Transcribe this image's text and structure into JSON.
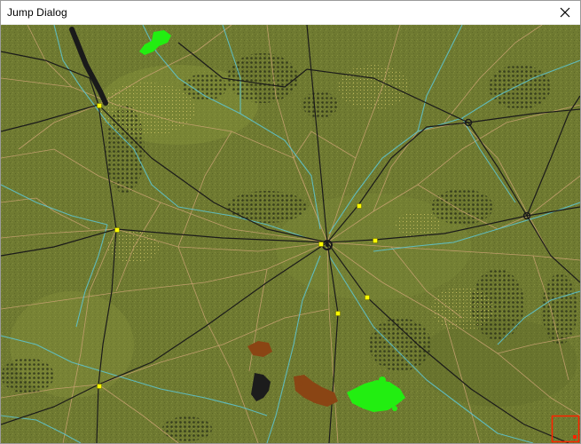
{
  "window": {
    "title": "Jump Dialog"
  },
  "icons": {
    "close": "close-icon"
  },
  "map": {
    "colors": {
      "terrain": "#6f7a31",
      "road_primary": "#1a1a1a",
      "road_secondary": "#c9a272",
      "river": "#5ec6d4",
      "town_marker": "#ffff00",
      "unit_green": "#22ee11",
      "unit_brown": "#8a4514",
      "unit_black": "#1c1c1c",
      "viewport_frame": "#ff2200"
    }
  }
}
